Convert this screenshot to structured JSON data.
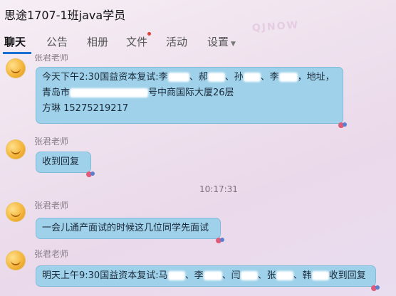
{
  "window": {
    "title": "思途1707-1班java学员"
  },
  "tabs": [
    {
      "label": "聊天",
      "active": true
    },
    {
      "label": "公告",
      "active": false
    },
    {
      "label": "相册",
      "active": false
    },
    {
      "label": "文件",
      "active": false,
      "has_notification": true
    },
    {
      "label": "活动",
      "active": false
    },
    {
      "label": "设置",
      "active": false,
      "dropdown": true
    }
  ],
  "watermark": {
    "text": "QJNOW"
  },
  "messages": [
    {
      "sender": "张君老师",
      "lines": [
        "今天下午2:30国益资本复试:李",
        "、郝",
        "、孙",
        "、李",
        "，地址，",
        "青岛市",
        "号中商国际大厦26层",
        "方琳 15275219217"
      ],
      "line1_link": "大厦"
    },
    {
      "sender": "张君老师",
      "lines": [
        "收到回复"
      ]
    },
    {
      "timestamp": "10:17:31"
    },
    {
      "sender": "张君老师",
      "lines": [
        "一会儿通产面试的时候这几位同学先面试"
      ]
    },
    {
      "sender": "张君老师",
      "lines": [
        "明天上午9:30国益资本复试:马",
        "、李",
        "、闫",
        "、张",
        "、韩",
        "收到回复"
      ]
    }
  ],
  "colors": {
    "bubble": "#9fd2ea",
    "bubble_border": "#7fbcd9",
    "active_tab_underline": "#1a6fd1",
    "notification_dot": "#e0403a"
  }
}
